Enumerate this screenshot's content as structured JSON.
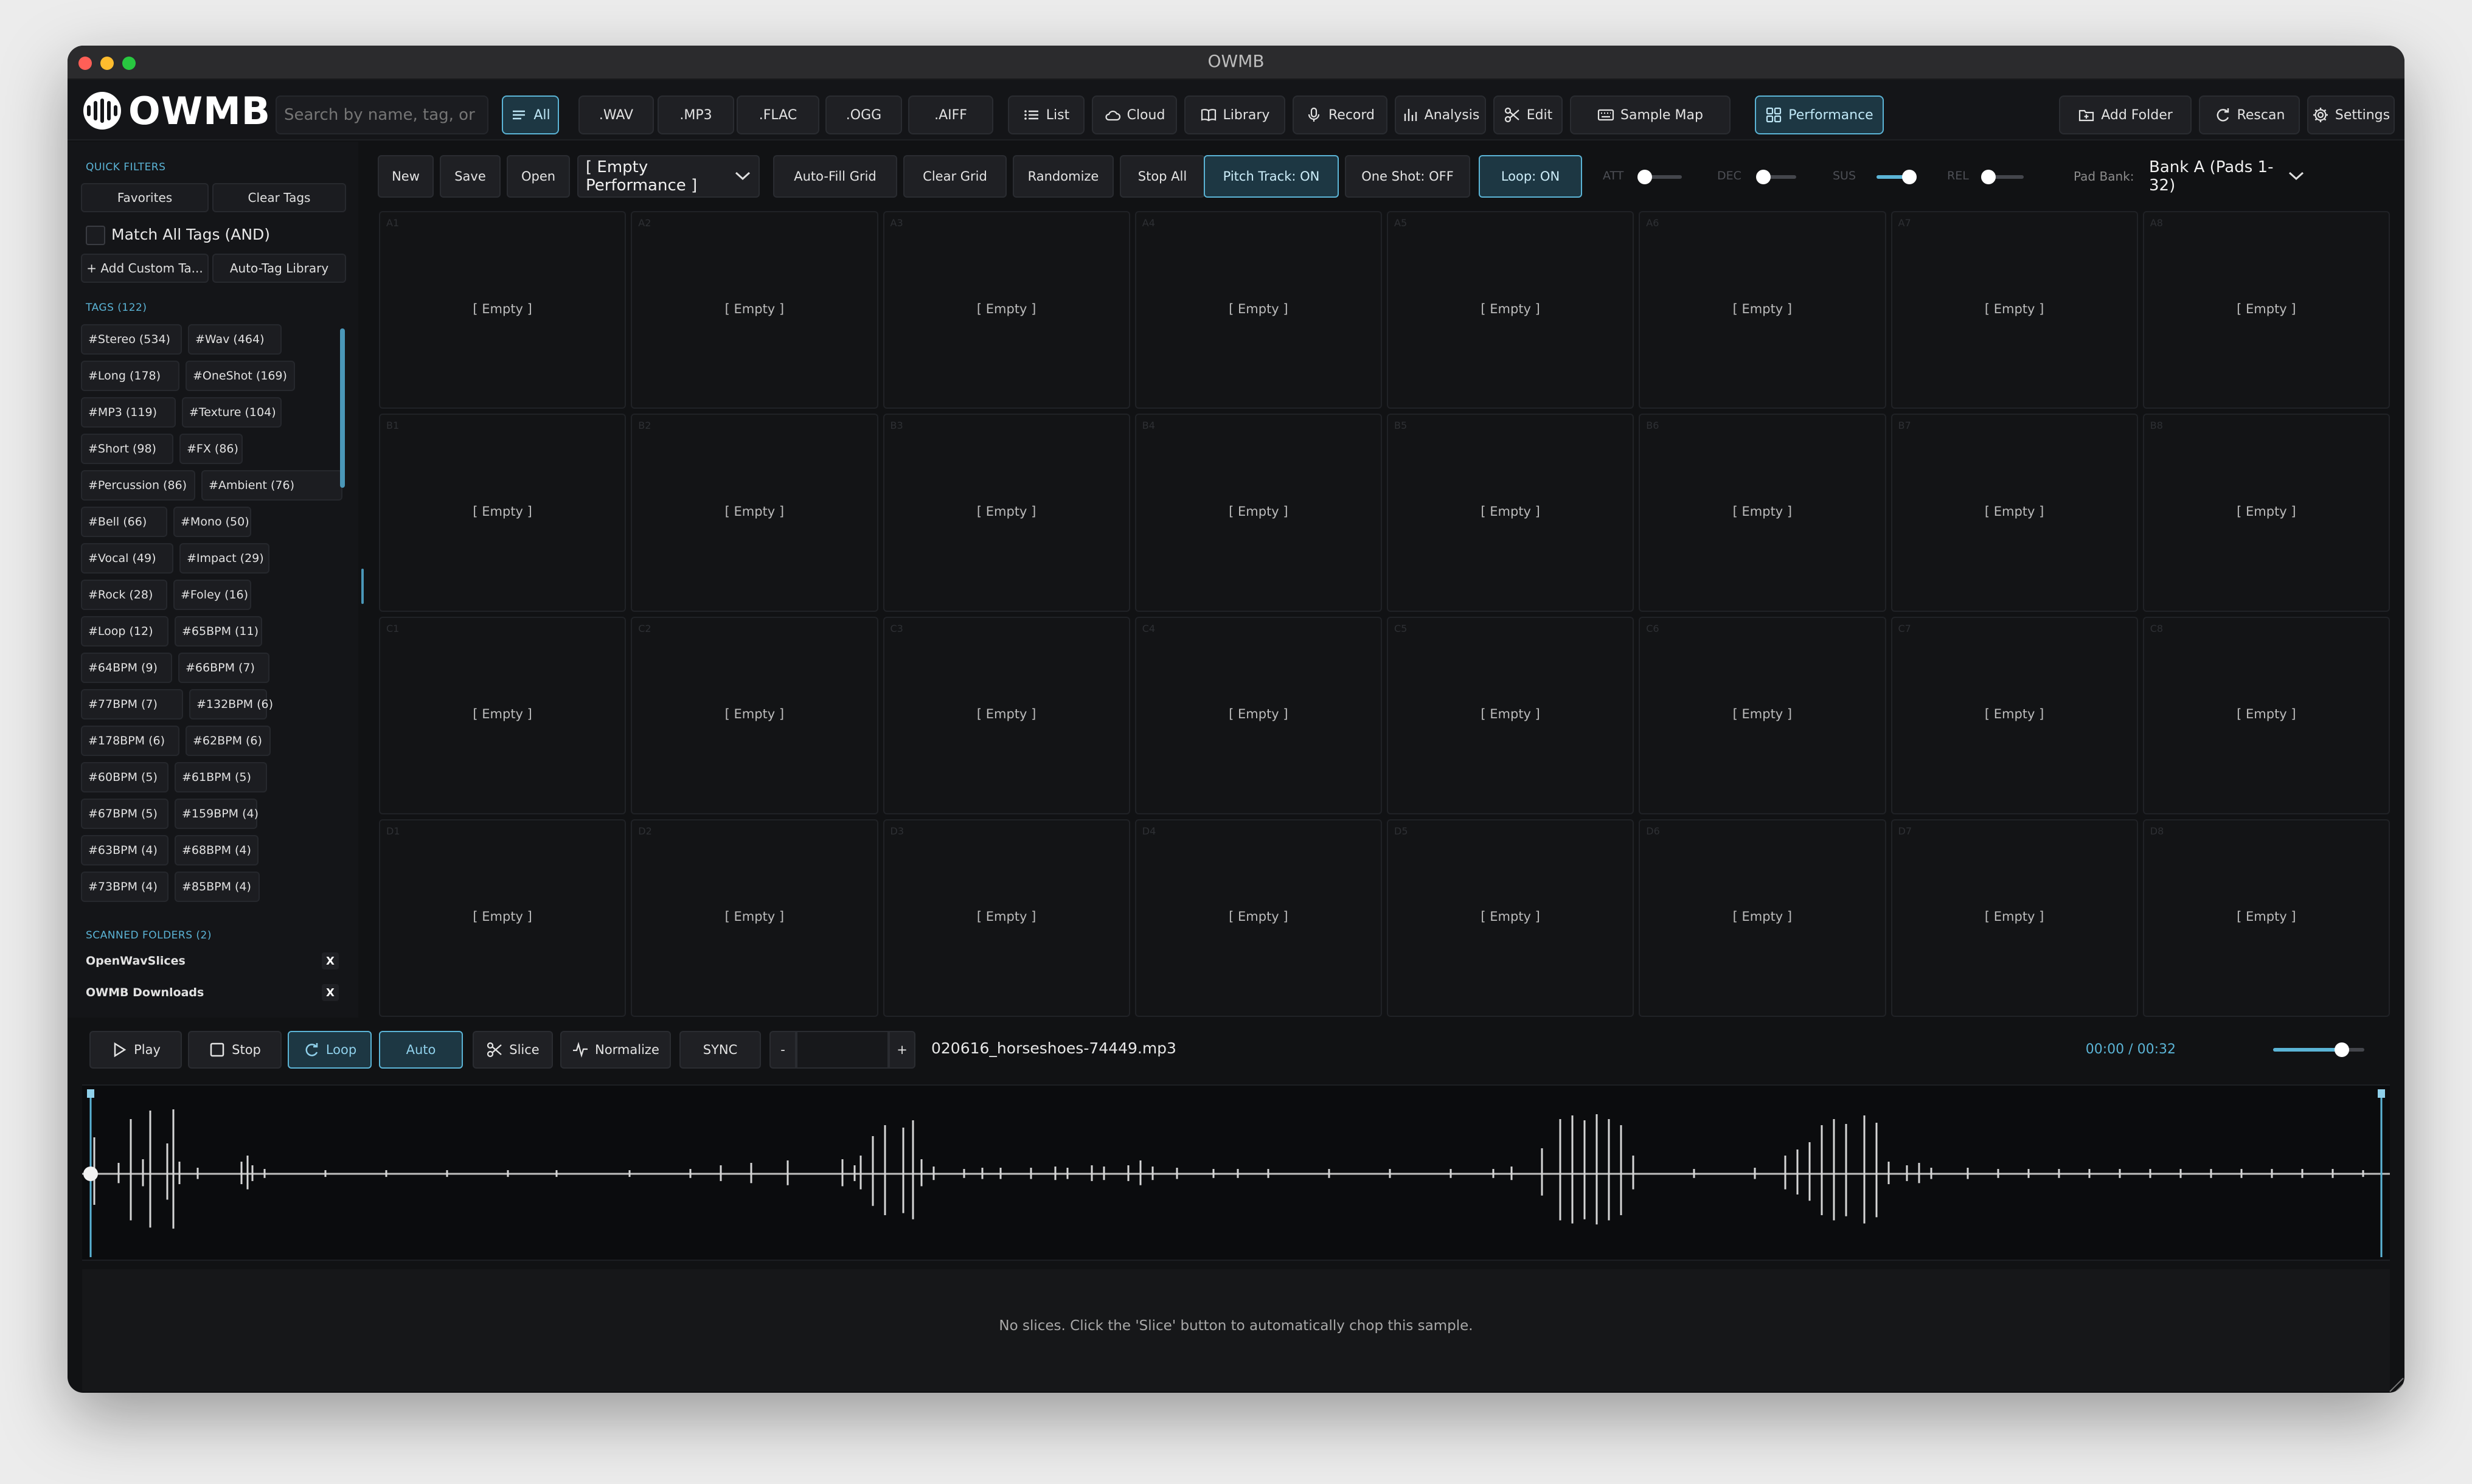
{
  "window": {
    "title": "OWMB"
  },
  "app": {
    "logo_text": "OWMB"
  },
  "search": {
    "placeholder": "Search by name, tag, or pa..."
  },
  "toolbar": {
    "formats": [
      {
        "label": "All",
        "icon": "menu-icon",
        "active": true
      },
      {
        "label": ".WAV"
      },
      {
        "label": ".MP3"
      },
      {
        "label": ".FLAC"
      },
      {
        "label": ".OGG"
      },
      {
        "label": ".AIFF"
      }
    ],
    "views": [
      {
        "label": "List",
        "icon": "list-icon"
      },
      {
        "label": "Cloud",
        "icon": "cloud-icon"
      },
      {
        "label": "Library",
        "icon": "book-icon"
      },
      {
        "label": "Record",
        "icon": "mic-icon"
      },
      {
        "label": "Analysis",
        "icon": "bar-chart-icon"
      },
      {
        "label": "Edit",
        "icon": "scissors-icon"
      },
      {
        "label": "Sample Map",
        "icon": "keyboard-icon"
      },
      {
        "label": "Performance",
        "icon": "grid-icon",
        "active": true
      }
    ],
    "right": [
      {
        "label": "Add Folder",
        "icon": "folder-plus-icon"
      },
      {
        "label": "Rescan",
        "icon": "refresh-icon"
      },
      {
        "label": "Settings",
        "icon": "gear-icon"
      }
    ]
  },
  "sidebar": {
    "quick_filters_title": "QUICK FILTERS",
    "favorites": "Favorites",
    "clear_tags": "Clear Tags",
    "match_all": "Match All Tags (AND)",
    "add_custom": "+ Add Custom Ta...",
    "auto_tag": "Auto-Tag Library",
    "tags_title": "TAGS (122)",
    "tags": [
      "#Stereo (534)",
      "#Wav (464)",
      "#Long (178)",
      "#OneShot (169)",
      "#MP3 (119)",
      "#Texture (104)",
      "#Short (98)",
      "#FX (86)",
      "#Percussion (86)",
      "#Ambient (76)",
      "#Bell (66)",
      "#Mono (50)",
      "#Vocal (49)",
      "#Impact (29)",
      "#Rock (28)",
      "#Foley (16)",
      "#Loop (12)",
      "#65BPM (11)",
      "#64BPM (9)",
      "#66BPM (7)",
      "#77BPM (7)",
      "#132BPM (6)",
      "#178BPM (6)",
      "#62BPM (6)",
      "#60BPM (5)",
      "#61BPM (5)",
      "#67BPM (5)",
      "#159BPM (4)",
      "#63BPM (4)",
      "#68BPM (4)",
      "#73BPM (4)",
      "#85BPM (4)"
    ],
    "folders_title": "SCANNED FOLDERS (2)",
    "folders": [
      "OpenWavSlices",
      "OWMB Downloads"
    ],
    "remove_label": "X"
  },
  "performance": {
    "new": "New",
    "save": "Save",
    "open": "Open",
    "preset": "[ Empty Performance ]",
    "auto_fill": "Auto-Fill Grid",
    "clear_grid": "Clear Grid",
    "randomize": "Randomize",
    "stop_all": "Stop All",
    "pitch_track": "Pitch Track: ON",
    "one_shot": "One Shot: OFF",
    "loop": "Loop: ON",
    "env": [
      {
        "label": "ATT",
        "value": 0.05
      },
      {
        "label": "DEC",
        "value": 0.15
      },
      {
        "label": "SUS",
        "value": 0.85
      },
      {
        "label": "REL",
        "value": 0.1
      }
    ],
    "pad_bank_label": "Pad Bank:",
    "pad_bank": "Bank A (Pads 1-32)",
    "empty_label": "[ Empty ]",
    "rows": [
      "A",
      "B",
      "C",
      "D"
    ],
    "columns": 8
  },
  "transport": {
    "play": "Play",
    "stop": "Stop",
    "loop": "Loop",
    "auto": "Auto",
    "slice": "Slice",
    "normalize": "Normalize",
    "sync": "SYNC",
    "minus": "-",
    "plus": "+",
    "bpm_value": "",
    "filename": "020616_horseshoes-74449.mp3",
    "time_current": "00:00",
    "time_sep": "/",
    "time_total": "00:32",
    "volume": 0.75
  },
  "slices": {
    "message": "No slices. Click the 'Slice' button to automatically chop this sample."
  },
  "colors": {
    "accent": "#5bb4d6",
    "bg": "#111214",
    "panel": "#141518"
  }
}
